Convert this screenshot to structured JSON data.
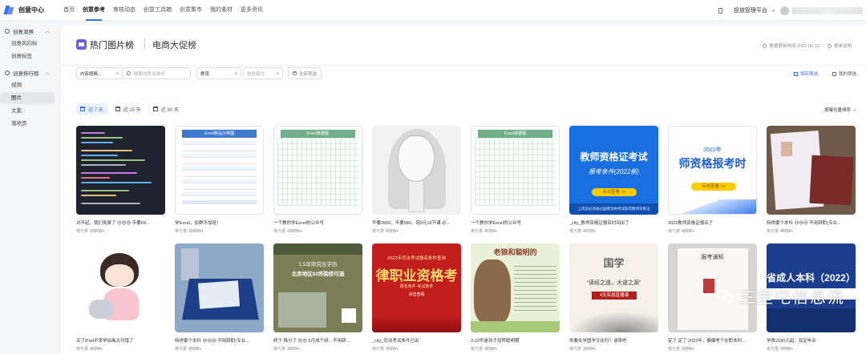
{
  "topbar": {
    "logo_text": "创意中心",
    "nav": [
      "首页",
      "创意参考",
      "审核动态",
      "创意工具箱",
      "创意集市",
      "我的素材",
      "更多资讯"
    ],
    "active_nav_index": 1,
    "platform_label": "投放管理平台"
  },
  "sidebar": {
    "groups": [
      {
        "label": "创意洞察",
        "items": [
          "创意风向标",
          "创意标签"
        ]
      },
      {
        "label": "创意排行榜",
        "items": [
          "视频",
          "图片",
          "文案",
          "落地页"
        ]
      }
    ],
    "active_item": "图片"
  },
  "header": {
    "title": "热门图片榜",
    "subtitle": "电商大促榜",
    "update_time": "数据更新时间 2022-06-12",
    "rules_label": "榜单说明"
  },
  "filters": {
    "category_select": "内容题略...",
    "search_placeholder": "搜索创意关键词",
    "industry_select": "教育",
    "position_placeholder": "投放版位",
    "all_filters_label": "全部筛选",
    "save_filter_label": "保存筛选",
    "my_filter_label": "我的筛选"
  },
  "tabs": [
    "近 7 天",
    "近 15 天",
    "近 30 天"
  ],
  "active_tab": 0,
  "sort_label": "按曝光量排序",
  "stat_label": "曝光量",
  "cards": [
    {
      "title": "对不起，我们免费了 😍😍😍 不要69...",
      "stat": "2000W+"
    },
    {
      "title": "学Excel，加群不加班！",
      "stat": "1000W+"
    },
    {
      "title": "一个教你学Excel的公众号",
      "stat": "1000W+"
    },
    {
      "title": "不要2800、不要580，现0元16节课 必...",
      "stat": "600W+"
    },
    {
      "title": "一个教你学Excel的公众号",
      "stat": "400W+"
    },
    {
      "title": "_city_教师资格证报名时间出了",
      "stat": "400W+"
    },
    {
      "title": "2022教师资格证报名了",
      "stat": "400W+"
    },
    {
      "title": "特得委个本科 😢😢😢 不用辞职(专业...",
      "stat": "400W+"
    },
    {
      "title": "买了iPad不来学绘画太可惜了",
      "stat": "400W+"
    },
    {
      "title": "特得委个本科 😢😢😢 不用辞职(专业...",
      "stat": "400W+"
    },
    {
      "title": "终于 降分了 😍😍 6月成个研，不用辞...",
      "stat": "300W+"
    },
    {
      "title": "_city_司法考试条件已出",
      "stat": "300W+"
    },
    {
      "title": "3-10岁是孩子培养聪明期",
      "stat": "300W+"
    },
    {
      "title": "你要去学国学文化吗？请来吧",
      "stat": "300W+"
    },
    {
      "title": "定了 定了 2022年，偏偏考个在职本科...",
      "stat": "300W+"
    },
    {
      "title": "学费2180元起，双证毕业",
      "stat": "300W+"
    }
  ],
  "thumb_text": {
    "sheet1_header": "Excel新品分类图",
    "sheet2_header": "Excel数据图",
    "sheet3_header": "Excel数据图",
    "teacher_big": "教师资格证考试",
    "teacher_sub": "报考条件(2022新)",
    "teacher_btn": "点击查看 >>",
    "teacher_foot": "上岗前必须通过国家资格考试取得教师资格证",
    "teacher2_year": "2022年",
    "teacher2_big": "师资格报考时",
    "teacher2_btn": "点击查看 >>",
    "green_t1": "1.5年研究生学历",
    "green_t2": "北京地区92所院校可选",
    "red_small": "2022年司法考试报名条件查询",
    "red_big": "律职业资格考",
    "red_b1": "报名条件·考试条件",
    "red_b2": "点击查看",
    "fox_title": "老狼和聪明的",
    "guoxue_big": "国学",
    "guoxue_sub": "“读经之道，大道之源”",
    "guoxue_tag": "4天实战直播课",
    "notice_title": "报考通知",
    "navy_big": "省成人本科（2022）"
  },
  "watermark": "三里屯信息流",
  "colors": {
    "accent": "#3370ff",
    "title_icon": "#6c5ce7",
    "teacher_blue": "#1a6fe0",
    "red_poster": "#c31e1e"
  }
}
